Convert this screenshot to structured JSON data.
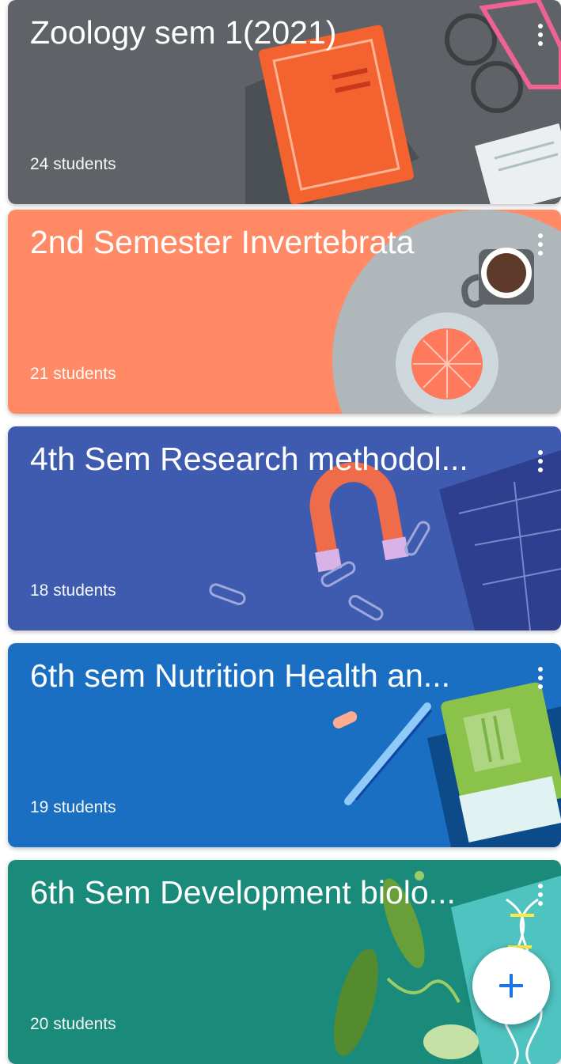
{
  "classes": [
    {
      "title": "Zoology sem 1(2021)",
      "students": "24 students",
      "color": "#5f6368"
    },
    {
      "title": "2nd Semester Invertebrata",
      "students": "21 students",
      "color": "#ff8a65"
    },
    {
      "title": "4th Sem Research methodol...",
      "students": "18 students",
      "color": "#3f5bb0"
    },
    {
      "title": "6th sem Nutrition Health an...",
      "students": "19 students",
      "color": "#1a6fc2"
    },
    {
      "title": "6th Sem Development biolo...",
      "students": "20 students",
      "color": "#1a8a7a"
    }
  ],
  "fab": {
    "icon": "plus-icon",
    "color": "#1a73e8"
  }
}
